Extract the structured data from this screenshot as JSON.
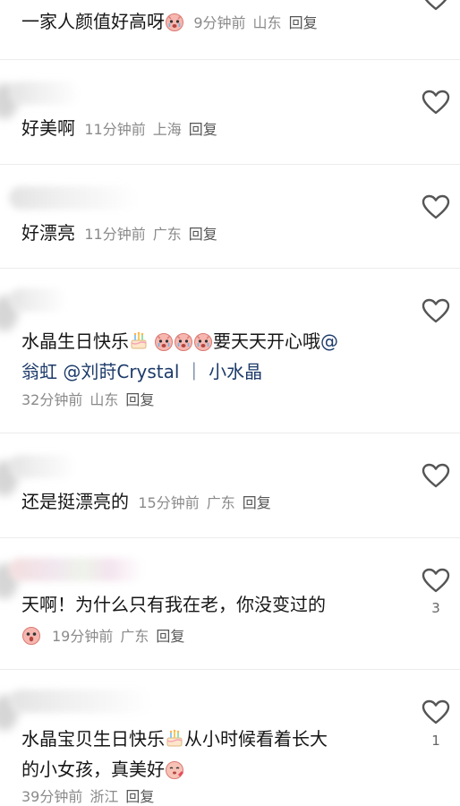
{
  "comments": [
    {
      "text": "一家人颜值好高呀",
      "emoji": "cute-cry-face-icon",
      "time": "9分钟前",
      "region": "山东",
      "reply": "回复"
    },
    {
      "text": "好美啊",
      "time": "11分钟前",
      "region": "上海",
      "reply": "回复"
    },
    {
      "text": "好漂亮",
      "time": "11分钟前",
      "region": "广东",
      "reply": "回复"
    },
    {
      "text_a": "水晶生日快乐",
      "text_b": "要天天开心哦",
      "mention_1": "@",
      "mention_2": "翁虹",
      "mention_3": "@刘莳Crystal ｜ 小水晶",
      "time": "32分钟前",
      "region": "山东",
      "reply": "回复"
    },
    {
      "text": "还是挺漂亮的",
      "time": "15分钟前",
      "region": "广东",
      "reply": "回复"
    },
    {
      "text": "天啊！为什么只有我在老，你没变过的",
      "time": "19分钟前",
      "region": "广东",
      "reply": "回复",
      "likes": "3"
    },
    {
      "text_a": "水晶宝贝生日快乐",
      "text_b": "从小时候看着长大",
      "text_c": "的小女孩，真美好",
      "time": "39分钟前",
      "region": "浙江",
      "reply": "回复",
      "likes": "1"
    }
  ],
  "colors": {
    "meta": "#8a8a8a",
    "mention": "#1d3b6a",
    "heart_stroke": "#555555"
  }
}
